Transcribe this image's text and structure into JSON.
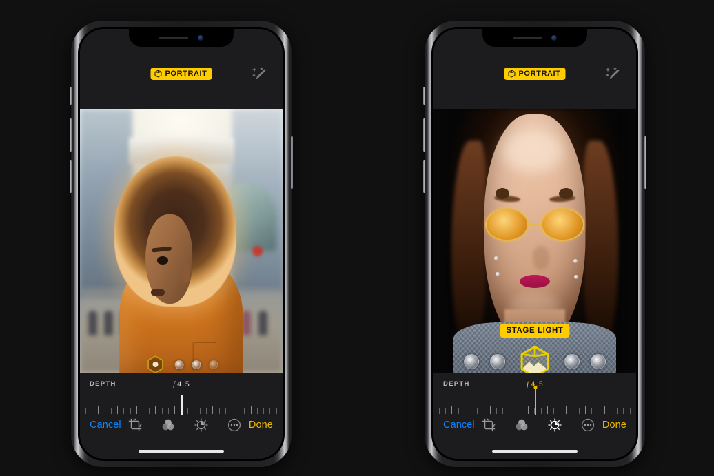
{
  "page": {
    "background_color": "#111111",
    "description": "Two iPhone mockups side by side showing the iOS Photos Portrait editing screen"
  },
  "phones": [
    {
      "id": "left",
      "screen_bg": "#1c1c1e",
      "top_bar": {
        "mode_badge": {
          "label": "PORTRAIT",
          "icon": "cube-icon",
          "bg_color": "#FFCC00",
          "text_color": "#141414"
        },
        "auto_enhance_icon": "magic-wand-icon"
      },
      "photo": {
        "alt": "Young man with large backlit afro hair in an orange t-shirt on a sunlit city street",
        "lighting_badge_visible": false
      },
      "lighting_picker": {
        "selected_effect_icon": "cube-icon",
        "selected_color": "#C79A12",
        "size": "small",
        "dot_count": 3
      },
      "depth_slider": {
        "label": "DEPTH",
        "value": "ƒ4.5",
        "value_color": "#d8d8dc",
        "needle_color": "#e9e9ee",
        "active": false,
        "tick_count": 31
      },
      "toolbar": {
        "cancel_label": "Cancel",
        "cancel_color": "#0A84FF",
        "done_label": "Done",
        "done_color": "#E8B900",
        "icons": [
          {
            "name": "crop-rotate-icon",
            "active": false
          },
          {
            "name": "filters-icon",
            "active": false
          },
          {
            "name": "adjust-icon",
            "active": false
          },
          {
            "name": "more-options-icon",
            "active": false
          }
        ]
      }
    },
    {
      "id": "right",
      "screen_bg": "#1c1c1e",
      "top_bar": {
        "mode_badge": {
          "label": "PORTRAIT",
          "icon": "cube-icon",
          "bg_color": "#FFCC00",
          "text_color": "#141414"
        },
        "auto_enhance_icon": "magic-wand-icon"
      },
      "photo": {
        "alt": "Woman wearing yellow-tinted oval sunglasses against a black stage-light background",
        "lighting_badge_visible": true,
        "lighting_badge": {
          "label": "STAGE LIGHT",
          "bg_color": "#FFCC00",
          "text_color": "#141414"
        }
      },
      "lighting_picker": {
        "selected_effect_icon": "cube-icon",
        "selected_color": "#E8D000",
        "size": "big",
        "dot_count": 4
      },
      "depth_slider": {
        "label": "DEPTH",
        "value": "ƒ4.5",
        "value_color": "#E8B900",
        "needle_color": "#E8B900",
        "active": true,
        "tick_count": 31
      },
      "toolbar": {
        "cancel_label": "Cancel",
        "cancel_color": "#0A84FF",
        "done_label": "Done",
        "done_color": "#E8B900",
        "icons": [
          {
            "name": "crop-rotate-icon",
            "active": false
          },
          {
            "name": "filters-icon",
            "active": false
          },
          {
            "name": "adjust-icon",
            "active": true
          },
          {
            "name": "more-options-icon",
            "active": false
          }
        ]
      }
    }
  ]
}
